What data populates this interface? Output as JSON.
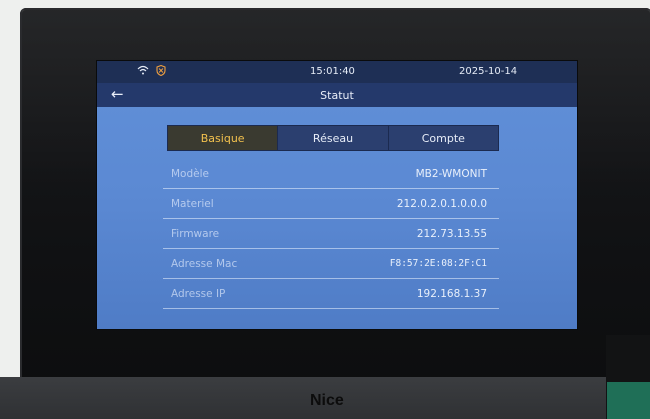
{
  "status_bar": {
    "time": "15:01:40",
    "date": "2025-10-14"
  },
  "header": {
    "back_icon": "back-arrow-icon",
    "title": "Statut"
  },
  "tabs": [
    {
      "label": "Basique",
      "active": true
    },
    {
      "label": "Réseau",
      "active": false
    },
    {
      "label": "Compte",
      "active": false
    }
  ],
  "info": [
    {
      "label": "Modèle",
      "value": "MB2-WMONIT"
    },
    {
      "label": "Materiel",
      "value": "212.0.2.0.1.0.0.0"
    },
    {
      "label": "Firmware",
      "value": "212.73.13.55"
    },
    {
      "label": "Adresse Mac",
      "value": "F8:57:2E:08:2F:C1"
    },
    {
      "label": "Adresse IP",
      "value": "192.168.1.37"
    }
  ],
  "device": {
    "brand": "Nice"
  },
  "colors": {
    "accent": "#f2c14e",
    "screen_bg": "#5b89d3",
    "header_bg": "#24396b"
  }
}
